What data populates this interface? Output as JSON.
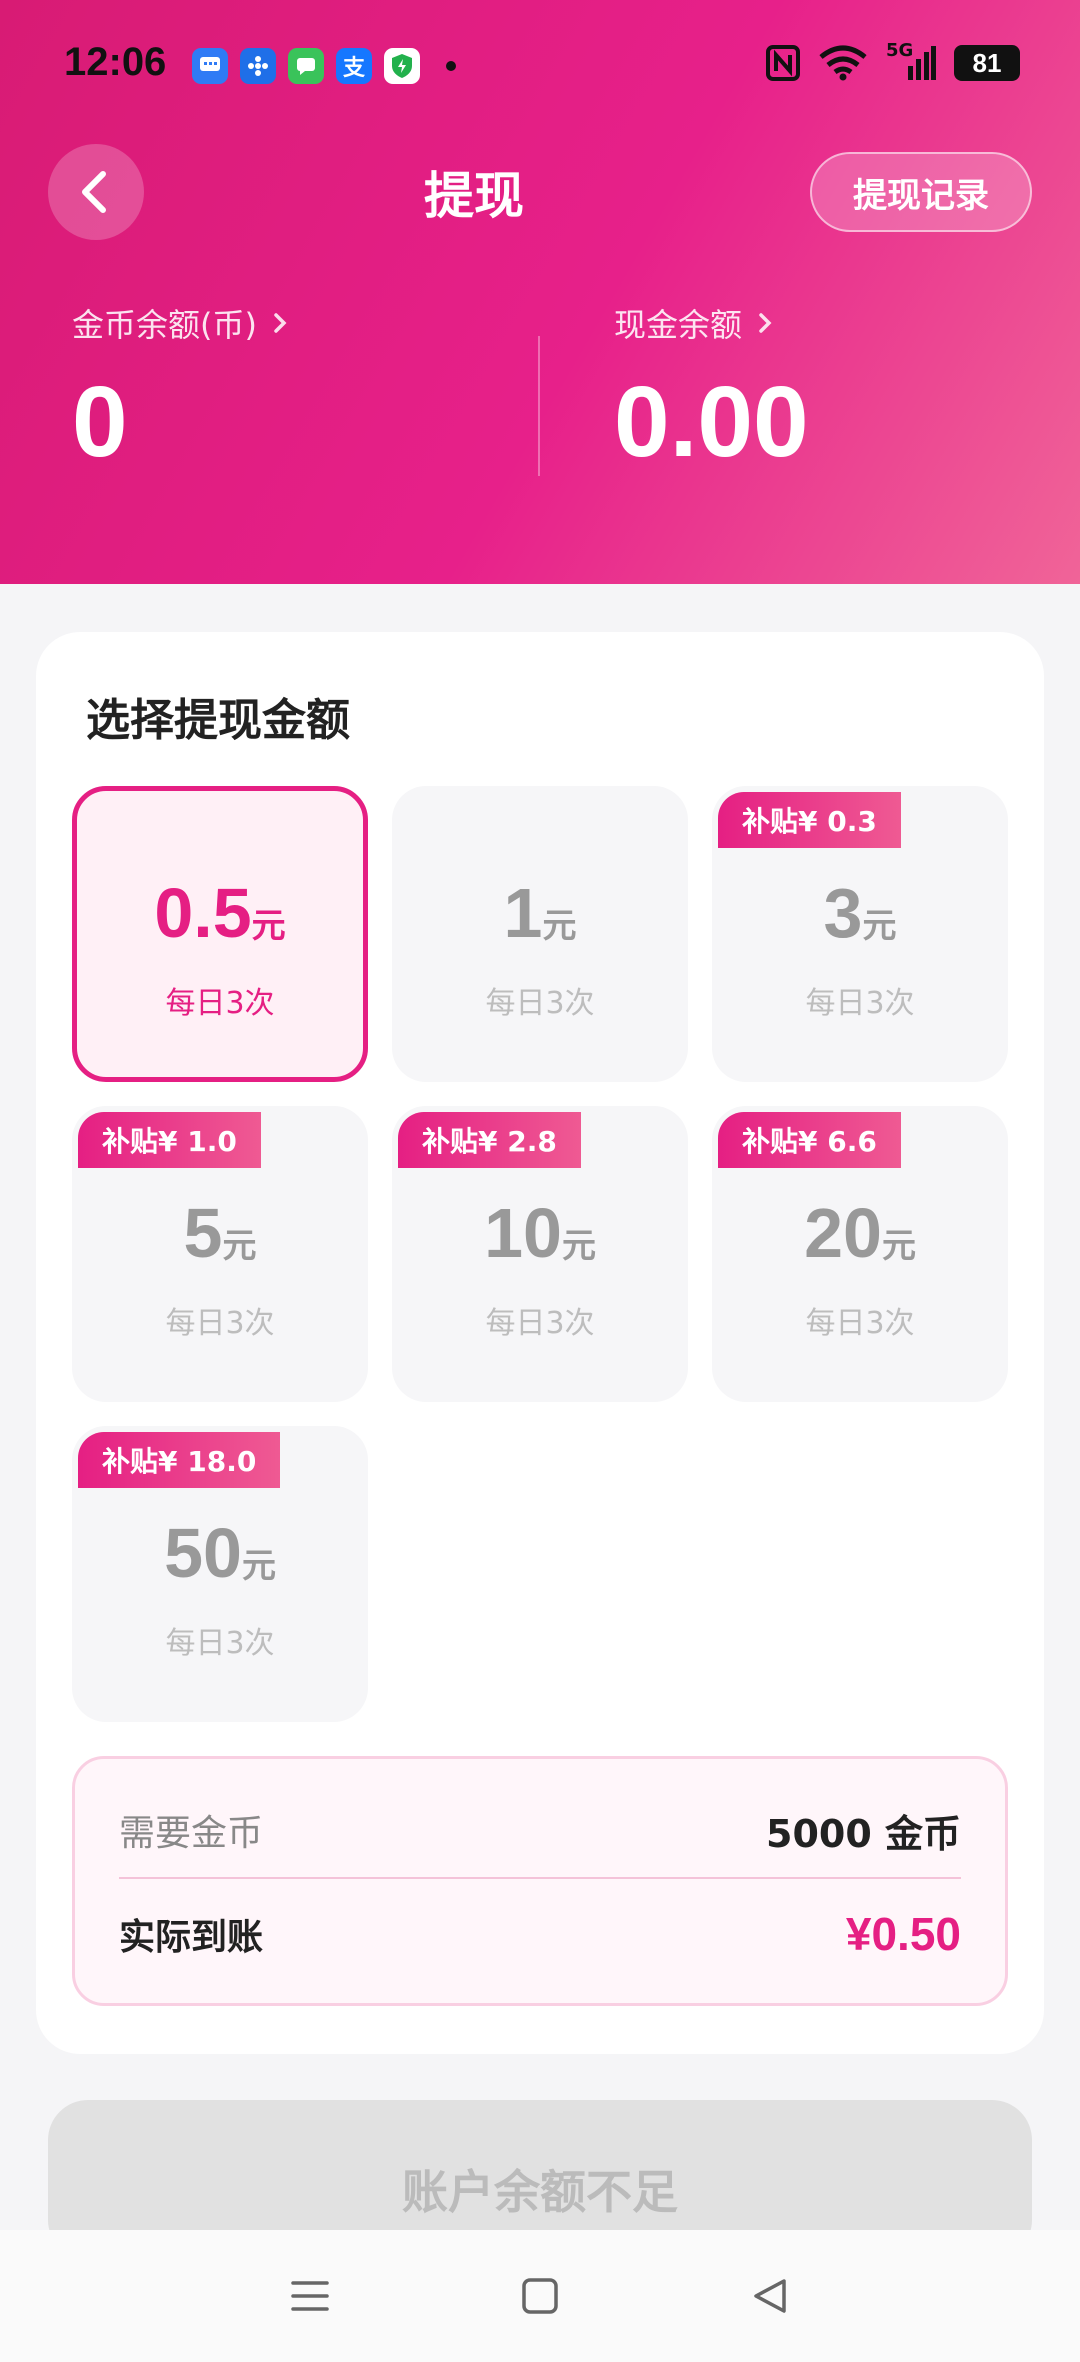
{
  "status_bar": {
    "time": "12:06",
    "battery": "81",
    "network": "5G",
    "app_icons": [
      "message-app-icon",
      "pinwheel-app-icon",
      "chat-app-icon",
      "alipay-app-icon",
      "security-app-icon"
    ],
    "alipay_glyph": "支"
  },
  "header": {
    "title": "提现",
    "record_button": "提现记录",
    "coin_balance_label": "金币余额(币)",
    "coin_balance_value": "0",
    "cash_balance_label": "现金余额",
    "cash_balance_value": "0.00"
  },
  "selector": {
    "title": "选择提现金额",
    "options": [
      {
        "amount": "0.5",
        "unit": "元",
        "limit": "每日3次",
        "badge": "",
        "selected": true
      },
      {
        "amount": "1",
        "unit": "元",
        "limit": "每日3次",
        "badge": "",
        "selected": false
      },
      {
        "amount": "3",
        "unit": "元",
        "limit": "每日3次",
        "badge": "补贴¥ 0.3",
        "selected": false
      },
      {
        "amount": "5",
        "unit": "元",
        "limit": "每日3次",
        "badge": "补贴¥ 1.0",
        "selected": false
      },
      {
        "amount": "10",
        "unit": "元",
        "limit": "每日3次",
        "badge": "补贴¥ 2.8",
        "selected": false
      },
      {
        "amount": "20",
        "unit": "元",
        "limit": "每日3次",
        "badge": "补贴¥ 6.6",
        "selected": false
      },
      {
        "amount": "50",
        "unit": "元",
        "limit": "每日3次",
        "badge": "补贴¥ 18.0",
        "selected": false
      }
    ]
  },
  "summary": {
    "required_label": "需要金币",
    "required_value": "5000 金币",
    "actual_label": "实际到账",
    "actual_value": "¥0.50"
  },
  "submit_button": "账户余额不足",
  "colors": {
    "accent": "#e51f83",
    "header_gradient_start": "#d81b74",
    "header_gradient_end": "#f06498",
    "disabled": "#e1e1e1"
  }
}
